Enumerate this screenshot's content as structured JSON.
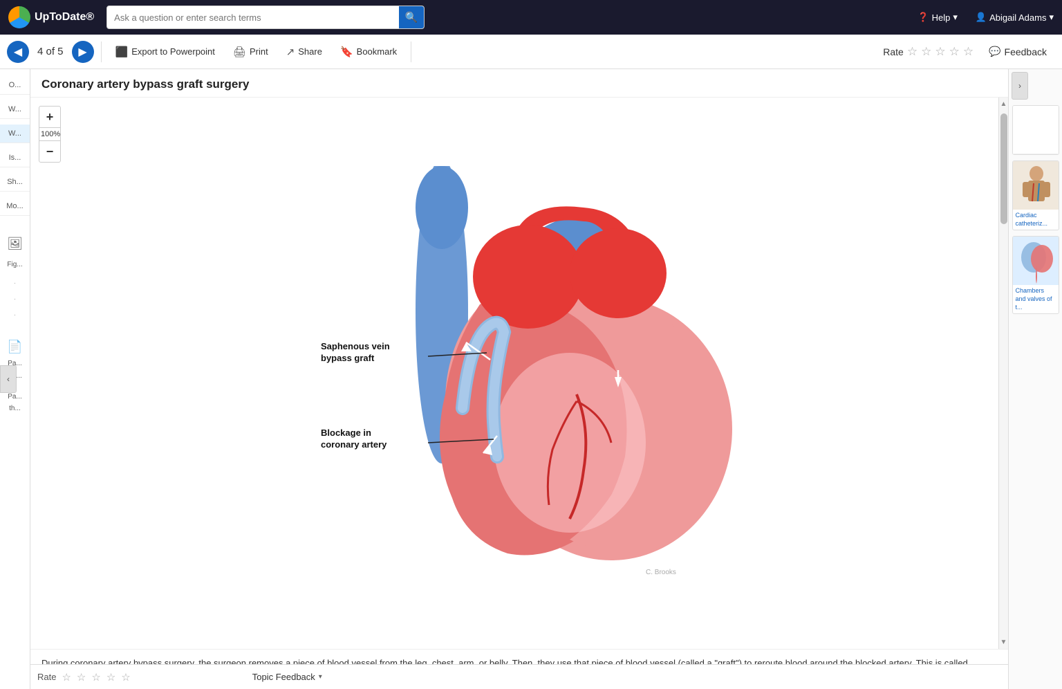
{
  "topNav": {
    "logo_text": "UpToDate®",
    "search_placeholder": "Ask a question or enter search terms",
    "help_label": "Help",
    "user_label": "Abigail Adams"
  },
  "toolbar": {
    "prev_label": "◀",
    "next_label": "▶",
    "page_indicator": "4 of 5",
    "export_label": "Export to Powerpoint",
    "print_label": "Print",
    "share_label": "Share",
    "bookmark_label": "Bookmark",
    "rate_label": "Rate",
    "feedback_label": "Feedback"
  },
  "figure": {
    "title": "Coronary artery bypass graft surgery",
    "zoom_level": "100%",
    "zoom_plus": "+",
    "zoom_minus": "−",
    "caption": "During coronary artery bypass surgery, the surgeon removes a piece of blood vessel from the leg, chest, arm, or belly. Then, they use that piece of blood vessel (called a \"graft\") to reroute blood around the blocked artery. This is called \"bypass surgery\" because it bypasses the blockage",
    "label1": "Saphenous vein bypass graft",
    "label2": "Blockage in coronary artery"
  },
  "rightPanel": {
    "expand_icon": "›",
    "thumbnails": [
      {
        "label": "Cardiac catheteriz..."
      },
      {
        "label": "Chambers and valves of t..."
      }
    ]
  },
  "bottomBar": {
    "rate_label": "Rate",
    "topic_feedback_label": "Topic Feedback"
  },
  "stars": [
    "☆",
    "☆",
    "☆",
    "☆",
    "☆"
  ]
}
